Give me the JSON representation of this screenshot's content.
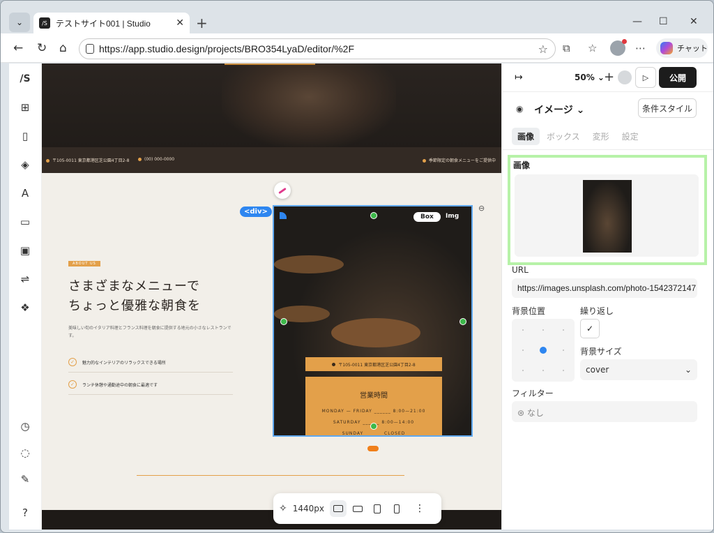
{
  "browser": {
    "tab_title": "テストサイト001 | Studio",
    "tab_favicon": "/S",
    "url": "https://app.studio.design/projects/BRO354LyaD/editor/%2F",
    "chat_label": "チャット"
  },
  "sidebar": {
    "logo": "/S",
    "icons": [
      "add-section-icon",
      "page-icon",
      "layers-icon",
      "font-icon",
      "folder-icon",
      "image-icon",
      "cms-icon",
      "component-icon",
      "history-icon",
      "comment-icon",
      "pen-icon",
      "help-icon"
    ],
    "help": "?"
  },
  "canvas": {
    "infobar": {
      "address": "〒105-0011 東京都港区芝公園4丁目2-8",
      "phone": "(00) 000-0000",
      "notice": "季節限定の朝食メニューをご提供中"
    },
    "about_badge": "ABOUT US",
    "heading_line1": "さまざまなメニューで",
    "heading_line2": "ちょっと優雅な朝食を",
    "description": "美味しい旬のイタリア料理とフランス料理を朝食に提供する地元の小さなレストランです。",
    "features": [
      "魅力的なインテリアのリラックスできる場所",
      "ランチ休憩や通勤途中の朝食に最適です"
    ],
    "selection": {
      "div_tag": "<div>",
      "box_tag": "Box",
      "img_tag": "Img"
    },
    "card": {
      "address": "〒105-0011 東京都港区芝公園4丁目2-8",
      "hours_title": "営業時間",
      "rows": [
        {
          "day": "MONDAY — FRIDAY",
          "time": "8:00—21:00"
        },
        {
          "day": "SATURDAY",
          "time": "8:00—14:00"
        },
        {
          "day": "SUNDAY",
          "time": "CLOSED"
        }
      ]
    }
  },
  "bottom_toolbar": {
    "width_label": "1440px",
    "devices": [
      "desktop-icon",
      "laptop-icon",
      "tablet-icon",
      "mobile-icon"
    ]
  },
  "right_panel": {
    "zoom": "50%",
    "publish": "公開",
    "element_title": "イメージ",
    "condition_style": "条件スタイル",
    "tabs": [
      "画像",
      "ボックス",
      "変形",
      "設定"
    ],
    "image_section_label": "画像",
    "url_label": "URL",
    "url_value": "https://images.unsplash.com/photo-1542372147",
    "bg_position_label": "背景位置",
    "repeat_label": "繰り返し",
    "repeat_checked": true,
    "bg_size_label": "背景サイズ",
    "bg_size_value": "cover",
    "filter_label": "フィルター",
    "filter_value": "なし"
  },
  "colors": {
    "accent": "#e3a04a",
    "selection": "#2e86f0",
    "highlight": "#b7f2a8"
  }
}
